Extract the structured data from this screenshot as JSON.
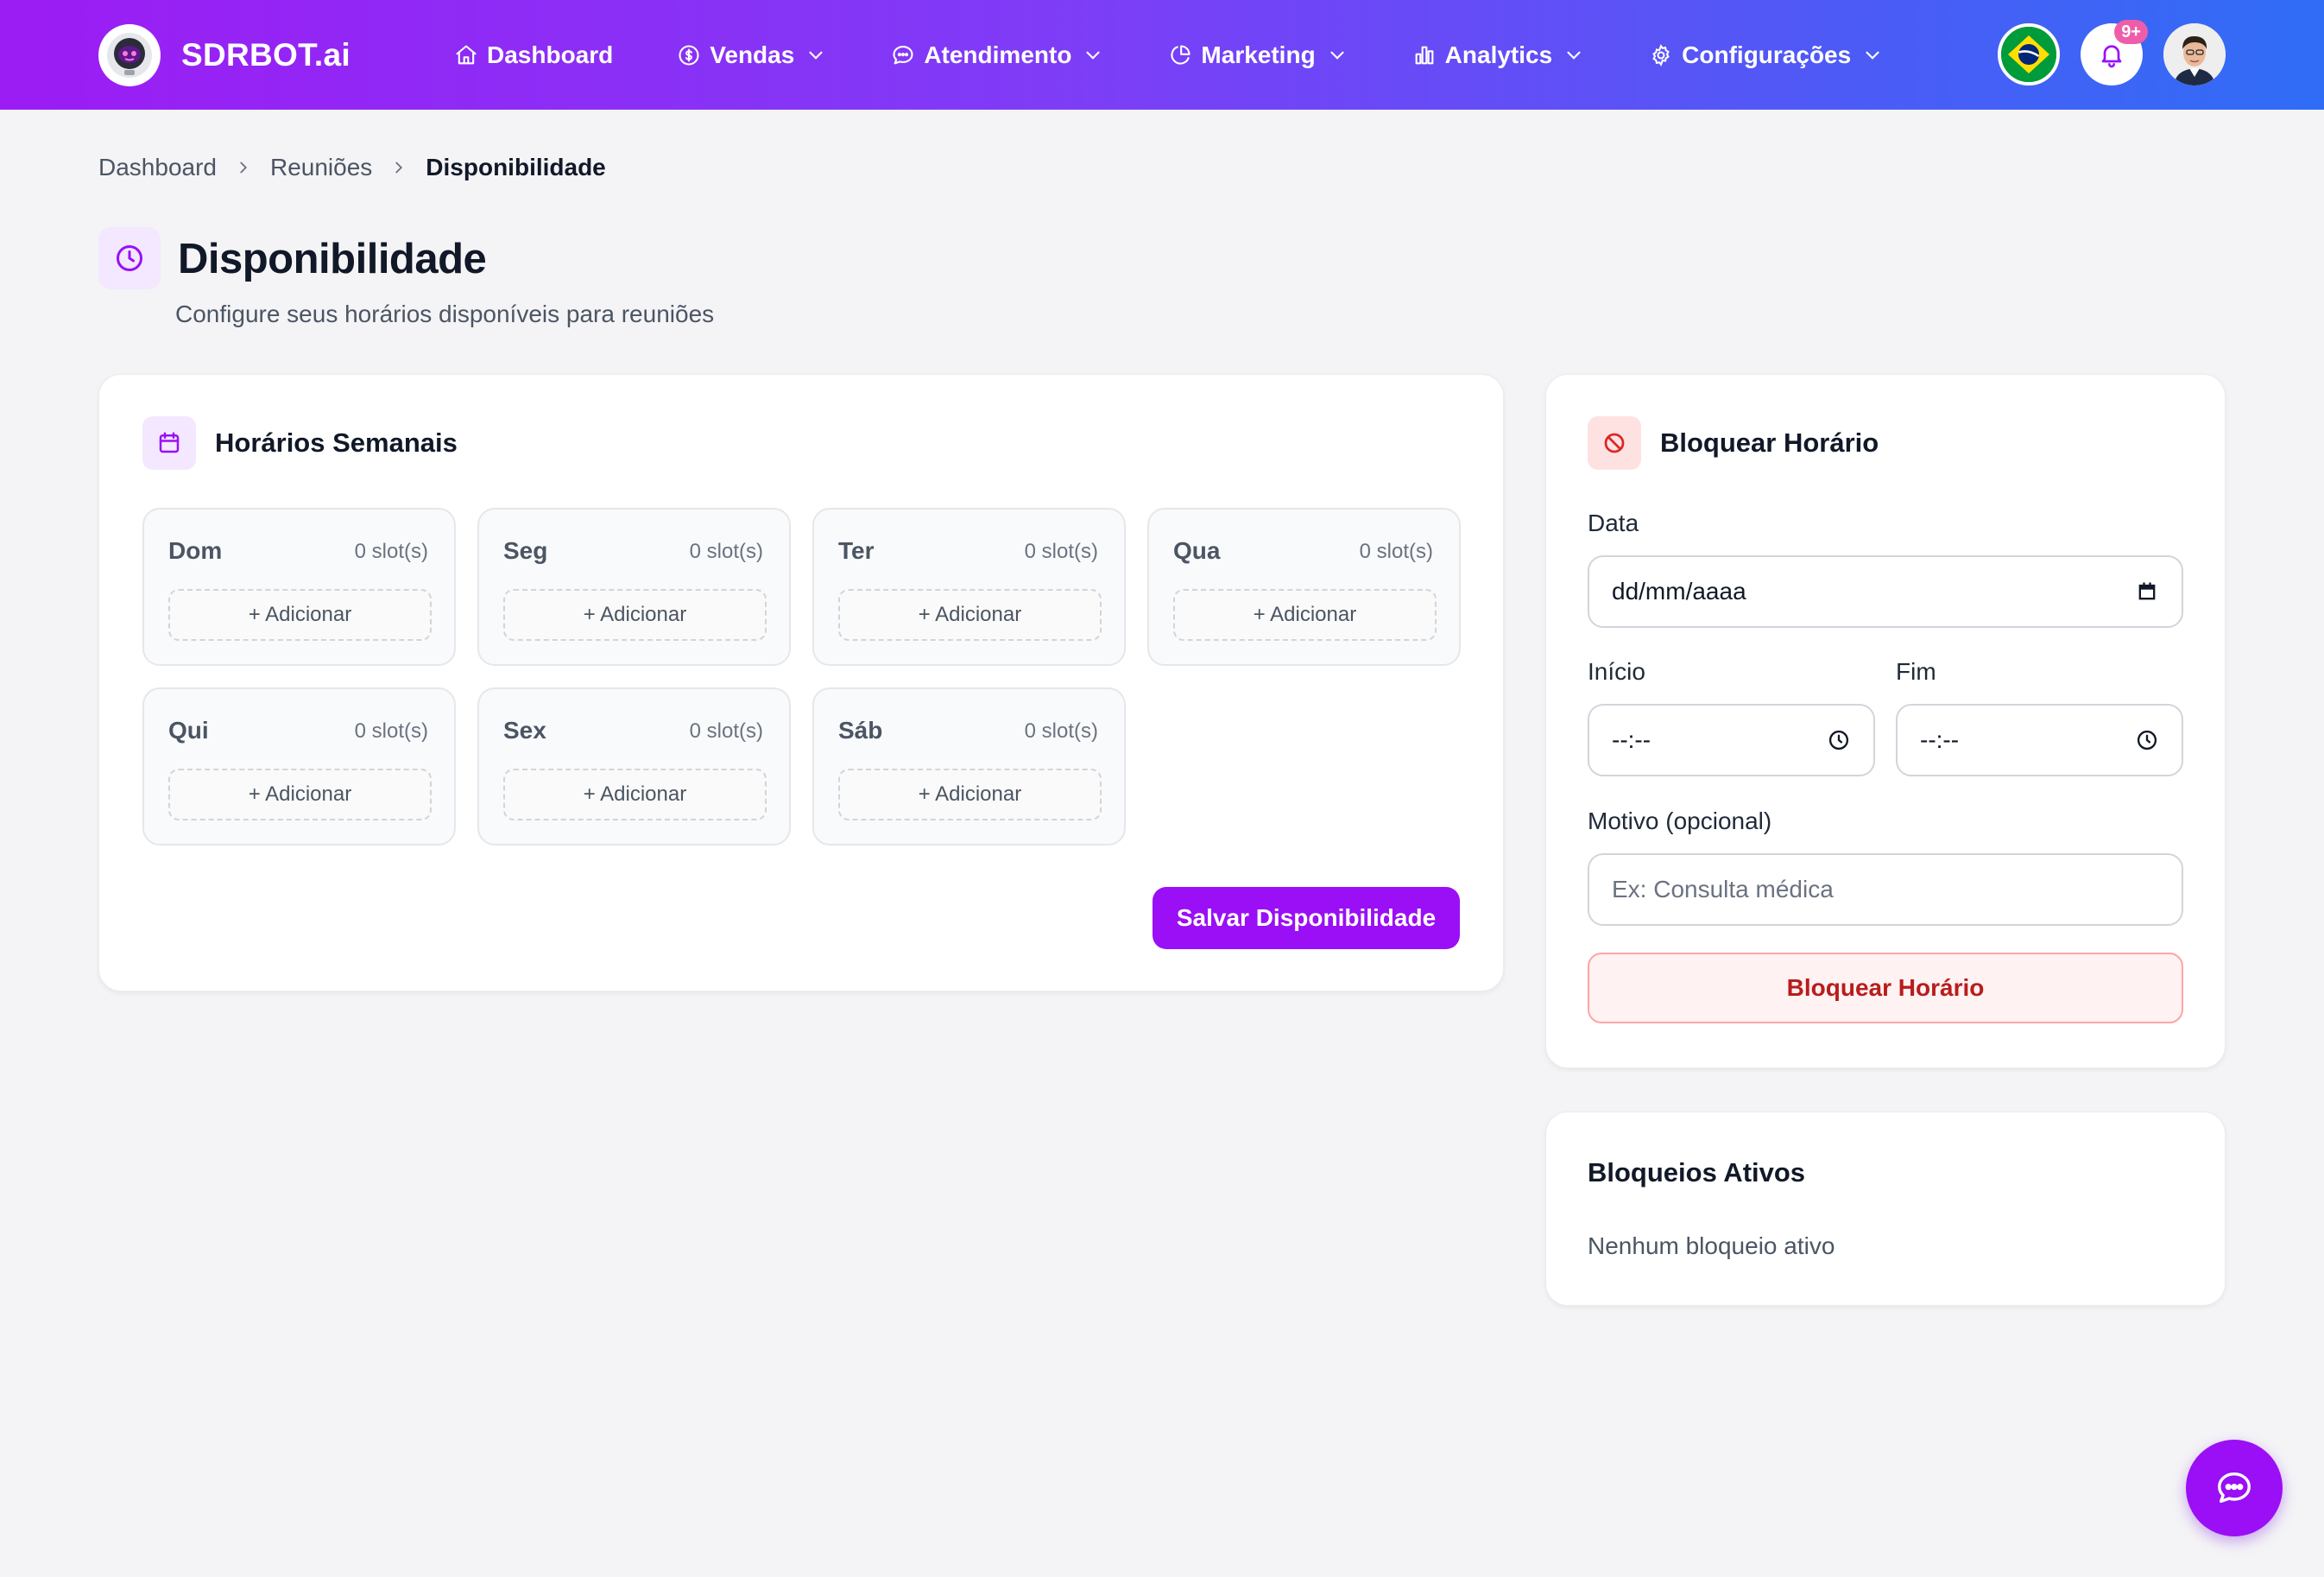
{
  "colors": {
    "accent": "#9a0ff5",
    "nav_gradient_start": "#9c1cf4",
    "nav_gradient_end": "#2f6df6",
    "danger": "#b91c1c",
    "badge": "#ef5da8"
  },
  "brand": {
    "name": "SDRBOT.ai",
    "logo_icon": "robot-icon"
  },
  "nav": {
    "items": [
      {
        "label": "Dashboard",
        "icon": "home-icon",
        "dropdown": false
      },
      {
        "label": "Vendas",
        "icon": "dollar-icon",
        "dropdown": true
      },
      {
        "label": "Atendimento",
        "icon": "chat-bubble-icon",
        "dropdown": true
      },
      {
        "label": "Marketing",
        "icon": "pie-chart-icon",
        "dropdown": true
      },
      {
        "label": "Analytics",
        "icon": "bar-chart-icon",
        "dropdown": true
      },
      {
        "label": "Configurações",
        "icon": "gear-icon",
        "dropdown": true
      }
    ],
    "notifications_badge": "9+"
  },
  "breadcrumb": {
    "items": [
      "Dashboard",
      "Reuniões",
      "Disponibilidade"
    ]
  },
  "header": {
    "title": "Disponibilidade",
    "subtitle": "Configure seus horários disponíveis para reuniões"
  },
  "weekly": {
    "title": "Horários Semanais",
    "days": [
      {
        "name": "Dom",
        "count": "0 slot(s)",
        "add_label": "+ Adicionar"
      },
      {
        "name": "Seg",
        "count": "0 slot(s)",
        "add_label": "+ Adicionar"
      },
      {
        "name": "Ter",
        "count": "0 slot(s)",
        "add_label": "+ Adicionar"
      },
      {
        "name": "Qua",
        "count": "0 slot(s)",
        "add_label": "+ Adicionar"
      },
      {
        "name": "Qui",
        "count": "0 slot(s)",
        "add_label": "+ Adicionar"
      },
      {
        "name": "Sex",
        "count": "0 slot(s)",
        "add_label": "+ Adicionar"
      },
      {
        "name": "Sáb",
        "count": "0 slot(s)",
        "add_label": "+ Adicionar"
      }
    ],
    "save_label": "Salvar Disponibilidade"
  },
  "block": {
    "title": "Bloquear Horário",
    "date_label": "Data",
    "date_value": "dd/mm/aaaa",
    "start_label": "Início",
    "start_value": "--:--",
    "end_label": "Fim",
    "end_value": "--:--",
    "reason_label": "Motivo (opcional)",
    "reason_placeholder": "Ex: Consulta médica",
    "submit_label": "Bloquear Horário"
  },
  "active_blocks": {
    "title": "Bloqueios Ativos",
    "empty_text": "Nenhum bloqueio ativo"
  }
}
